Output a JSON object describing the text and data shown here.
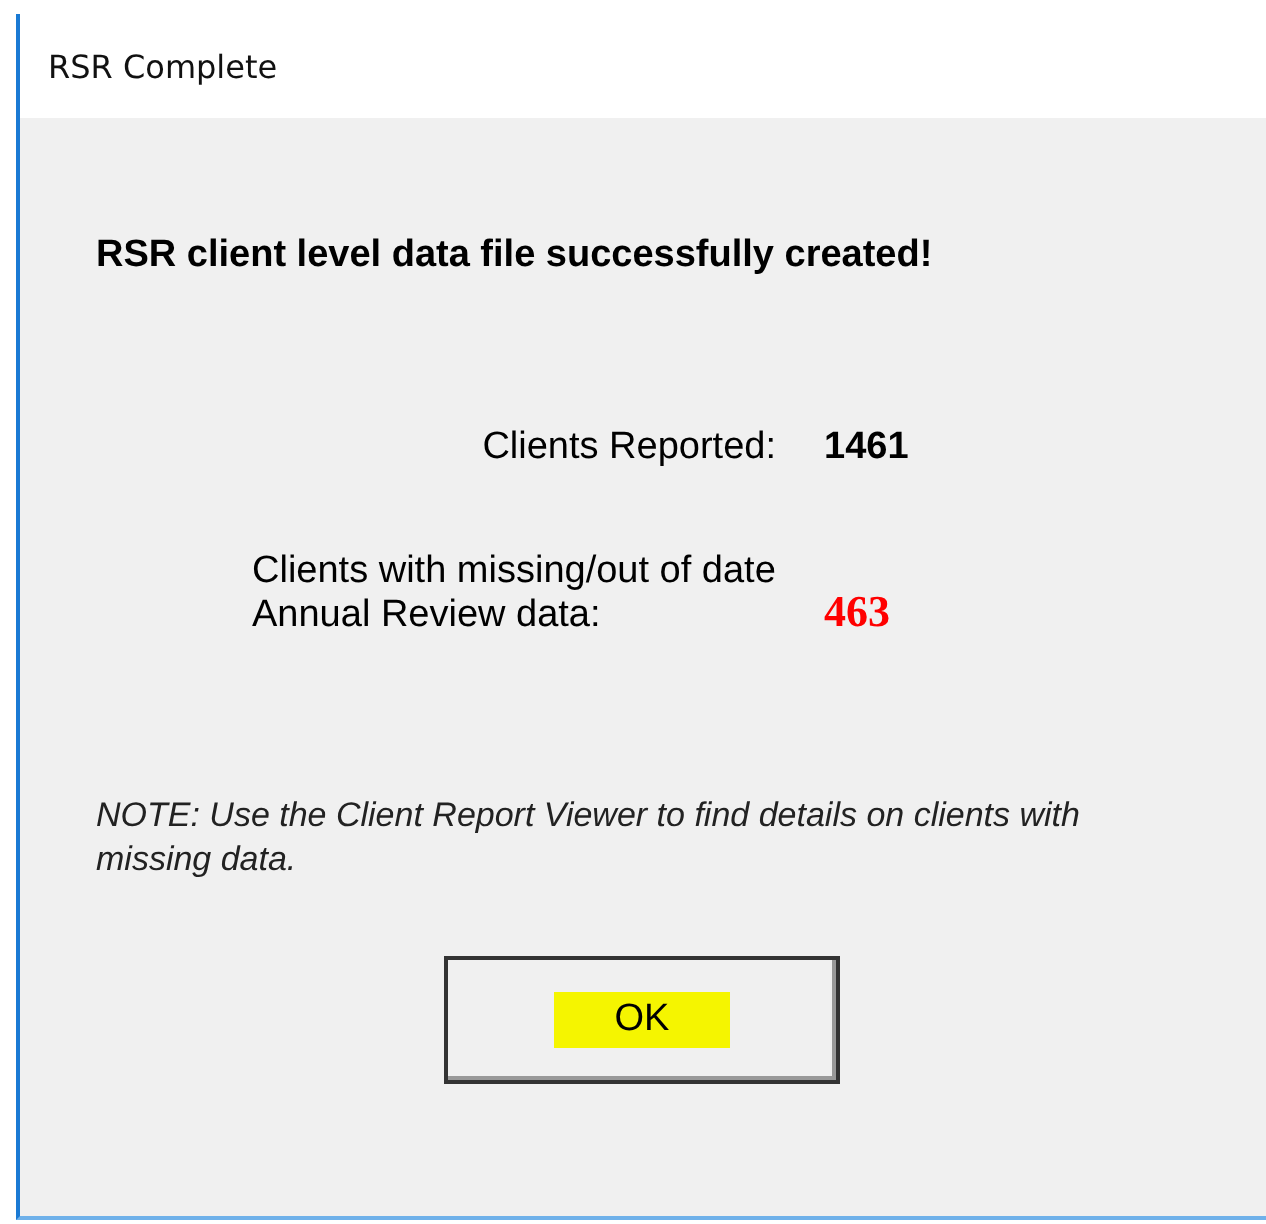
{
  "window": {
    "title": "RSR Complete"
  },
  "heading": "RSR client level data file successfully created!",
  "stats": [
    {
      "label": "Clients Reported:",
      "value": "1461",
      "color": "#000000"
    },
    {
      "label": "Clients with missing/out of date Annual Review data:",
      "value": "463",
      "color": "#ff0000"
    }
  ],
  "note": "NOTE: Use the Client Report Viewer to find details on clients with missing data.",
  "button": {
    "label": "OK",
    "highlighted": true
  }
}
